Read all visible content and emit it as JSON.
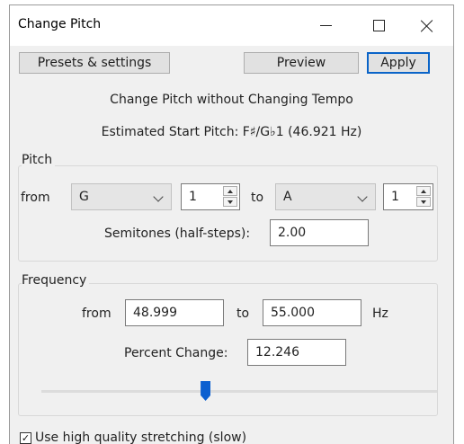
{
  "window": {
    "title": "Change Pitch",
    "controls": {
      "minimize_icon": "minimize-icon",
      "maximize_icon": "maximize-icon",
      "close_icon": "close-icon"
    }
  },
  "toolbar": {
    "presets_label": "Presets & settings",
    "preview_label": "Preview",
    "apply_label": "Apply"
  },
  "header": {
    "heading": "Change Pitch without Changing Tempo",
    "estimated_start_pitch": "Estimated Start Pitch: F♯/G♭1 (46.921 Hz)"
  },
  "pitch": {
    "group_label": "Pitch",
    "from_label": "from",
    "to_label": "to",
    "from_note": "G",
    "from_octave": "1",
    "to_note": "A",
    "to_octave": "1",
    "semitones_label": "Semitones (half-steps):",
    "semitones_value": "2.00"
  },
  "frequency": {
    "group_label": "Frequency",
    "from_label": "from",
    "to_label": "to",
    "from_value": "48.999",
    "to_value": "55.000",
    "unit": "Hz",
    "percent_label": "Percent Change:",
    "percent_value": "12.246",
    "slider_value_percent": 12.246
  },
  "options": {
    "high_quality_label": "Use high quality stretching (slow)",
    "high_quality_checked": true,
    "check_glyph": "✓"
  },
  "colors": {
    "accent": "#0a64c8",
    "slider_thumb": "#0b5fd0",
    "dialog_bg": "#f0f0f0"
  }
}
